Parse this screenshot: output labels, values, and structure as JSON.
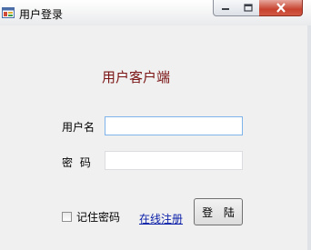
{
  "window": {
    "title": "用户登录",
    "controls": {
      "minimize": "minimize",
      "maximize": "maximize",
      "close": "close"
    }
  },
  "form": {
    "heading": "用户客户端",
    "username_label": "用户名",
    "username_value": "",
    "password_label": "密 码",
    "password_value": "",
    "remember_label": "记住密码",
    "remember_checked": false,
    "register_link": "在线注册",
    "login_button": "登 陆"
  },
  "colors": {
    "heading": "#7a1414",
    "link": "#0a1ea8",
    "close_button": "#c7432f",
    "background": "#f0f0f0"
  }
}
